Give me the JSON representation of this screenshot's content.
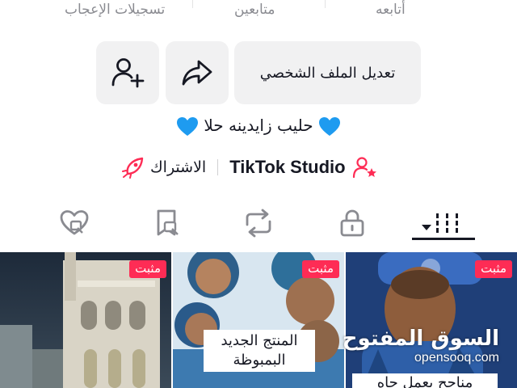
{
  "stats": {
    "likes_label": "تسجيلات الإعجاب",
    "followers_label": "متابعين",
    "following_label": "أتابعه"
  },
  "actions": {
    "edit_profile_label": "تعديل الملف الشخصي"
  },
  "bio": {
    "text": "حليب زايدينه حلا",
    "heart_color": "#1e9bf0"
  },
  "links": {
    "subscribe_label": "الاشتراك",
    "studio_label": "TikTok Studio",
    "accent_color": "#fe2c55"
  },
  "tabs": [
    {
      "name": "videos",
      "icon": "grid-icon",
      "active": true
    },
    {
      "name": "private",
      "icon": "lock-icon",
      "active": false
    },
    {
      "name": "reposts",
      "icon": "repost-icon",
      "active": false
    },
    {
      "name": "favorites",
      "icon": "bookmark-icon",
      "active": false
    },
    {
      "name": "liked",
      "icon": "heart-icon",
      "active": false
    }
  ],
  "videos": [
    {
      "pinned_label": "مثبت",
      "caption": "مناجح يعمل جاه"
    },
    {
      "pinned_label": "مثبت",
      "caption": "المنتج الجديد البمبوظة"
    },
    {
      "pinned_label": "مثبت",
      "caption": ""
    }
  ],
  "watermark": {
    "arabic": "السوق المفتوح",
    "latin": "opensooq.com"
  }
}
